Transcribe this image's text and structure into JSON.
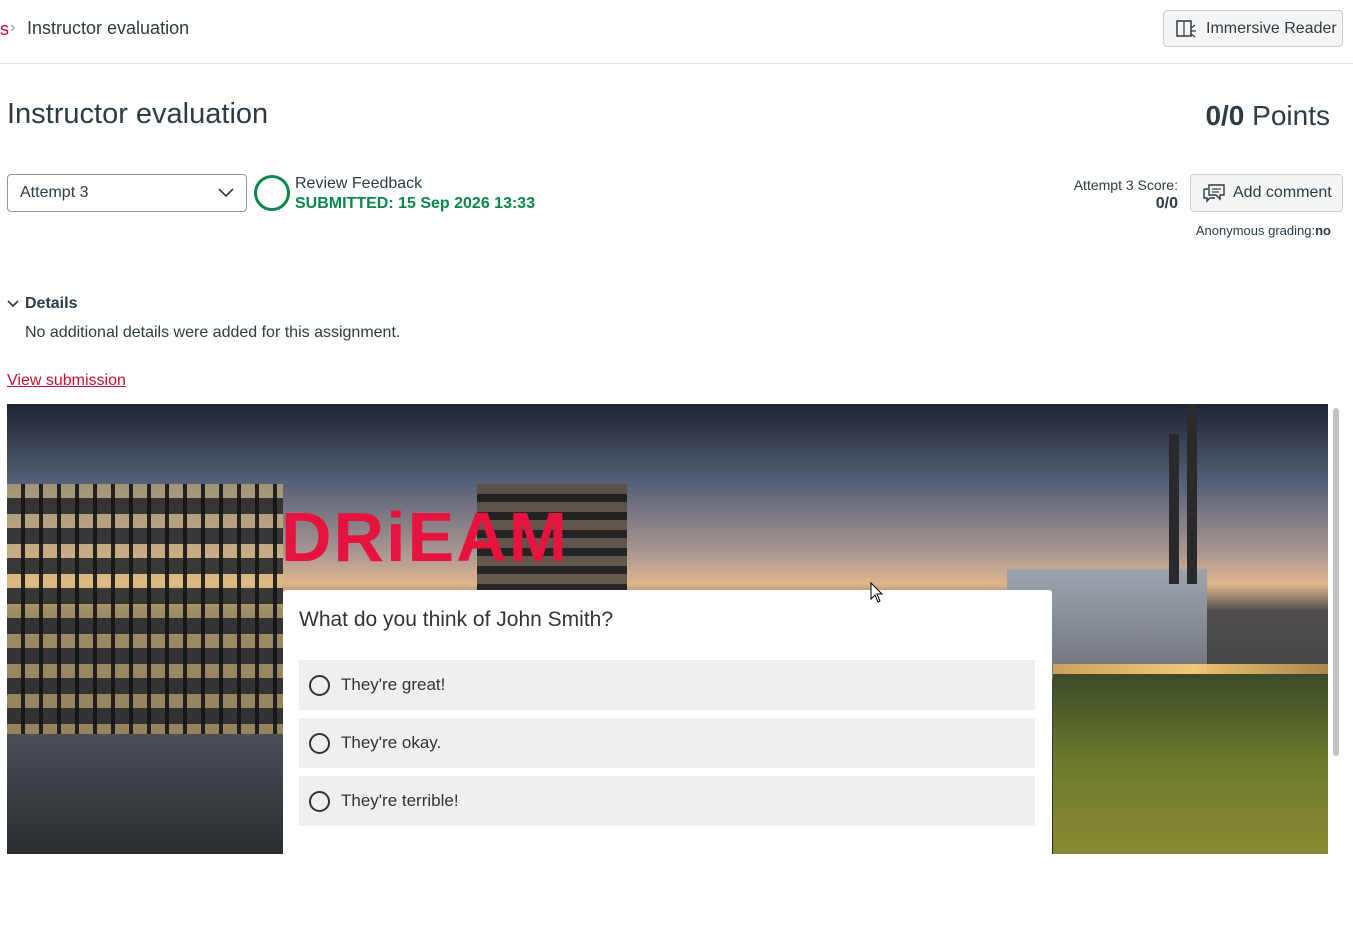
{
  "breadcrumb": {
    "previous": "s",
    "separator": "›",
    "current": "Instructor evaluation"
  },
  "header": {
    "immersive_reader_label": "Immersive Reader"
  },
  "assignment": {
    "title": "Instructor evaluation",
    "points_value": "0/0",
    "points_suffix": " Points"
  },
  "attempt": {
    "selected": "Attempt 3",
    "review_label": "Review Feedback",
    "submitted_text": "SUBMITTED: 15 Sep 2026 13:33",
    "score_label": "Attempt 3 Score:",
    "score_value": "0/0",
    "add_comment_label": "Add comment",
    "anonymous_label": "Anonymous grading:",
    "anonymous_value": "no"
  },
  "details": {
    "toggle_label": "Details",
    "text": "No additional details were added for this assignment."
  },
  "view_submission_label": "View submission",
  "embedded": {
    "logo_text": "DRiEAM",
    "question": "What do you think of John Smith?",
    "options": [
      "They're great!",
      "They're okay.",
      "They're terrible!"
    ]
  },
  "colors": {
    "brand_red": "#c8102e",
    "success_green": "#0b874b",
    "logo_red": "#e5133d"
  }
}
